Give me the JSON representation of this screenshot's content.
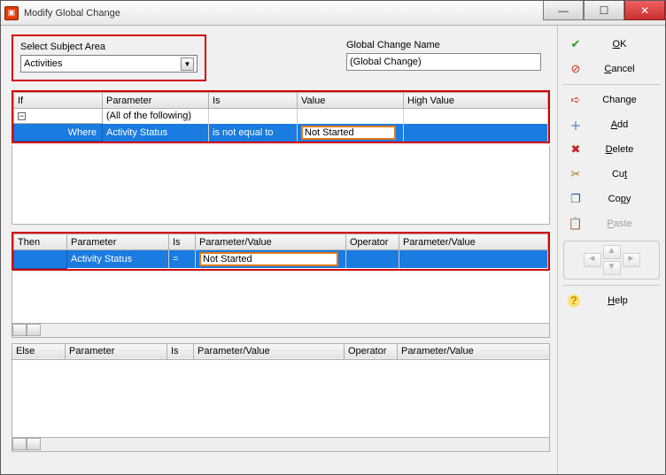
{
  "window": {
    "title": "Modify Global Change"
  },
  "labels": {
    "subject_area": "Select Subject Area",
    "change_name": "Global Change Name"
  },
  "fields": {
    "subject_area_value": "Activities",
    "change_name_value": "(Global Change)"
  },
  "section_if": {
    "row_label": "If",
    "headers": {
      "parameter": "Parameter",
      "is": "Is",
      "value": "Value",
      "high_value": "High Value"
    },
    "rows": [
      {
        "rowhead": "",
        "parameter": "(All of the following)",
        "is": "",
        "value": "",
        "high": "",
        "type": "group"
      },
      {
        "rowhead": "Where",
        "parameter": "Activity Status",
        "is": "is not equal to",
        "value": "Not Started",
        "high": "",
        "type": "sel"
      }
    ]
  },
  "section_then": {
    "row_label": "Then",
    "headers": {
      "parameter": "Parameter",
      "is": "Is",
      "pv1": "Parameter/Value",
      "operator": "Operator",
      "pv2": "Parameter/Value"
    },
    "rows": [
      {
        "rowhead": "",
        "parameter": "Activity Status",
        "is": "=",
        "pv1": "Not Started",
        "operator": "",
        "pv2": "",
        "type": "sel"
      }
    ]
  },
  "section_else": {
    "row_label": "Else",
    "headers": {
      "parameter": "Parameter",
      "is": "Is",
      "pv1": "Parameter/Value",
      "operator": "Operator",
      "pv2": "Parameter/Value"
    }
  },
  "buttons": {
    "ok": "OK",
    "cancel": "Cancel",
    "change": "Change",
    "add": "Add",
    "delete": "Delete",
    "cut": "Cut",
    "copy": "Copy",
    "paste": "Paste",
    "help": "Help"
  },
  "icons": {
    "ok": "✔",
    "cancel": "⊘",
    "change": "➪",
    "add": "＋",
    "delete": "✖",
    "cut": "✂",
    "copy": "❐",
    "paste": "📋",
    "help": "?"
  }
}
